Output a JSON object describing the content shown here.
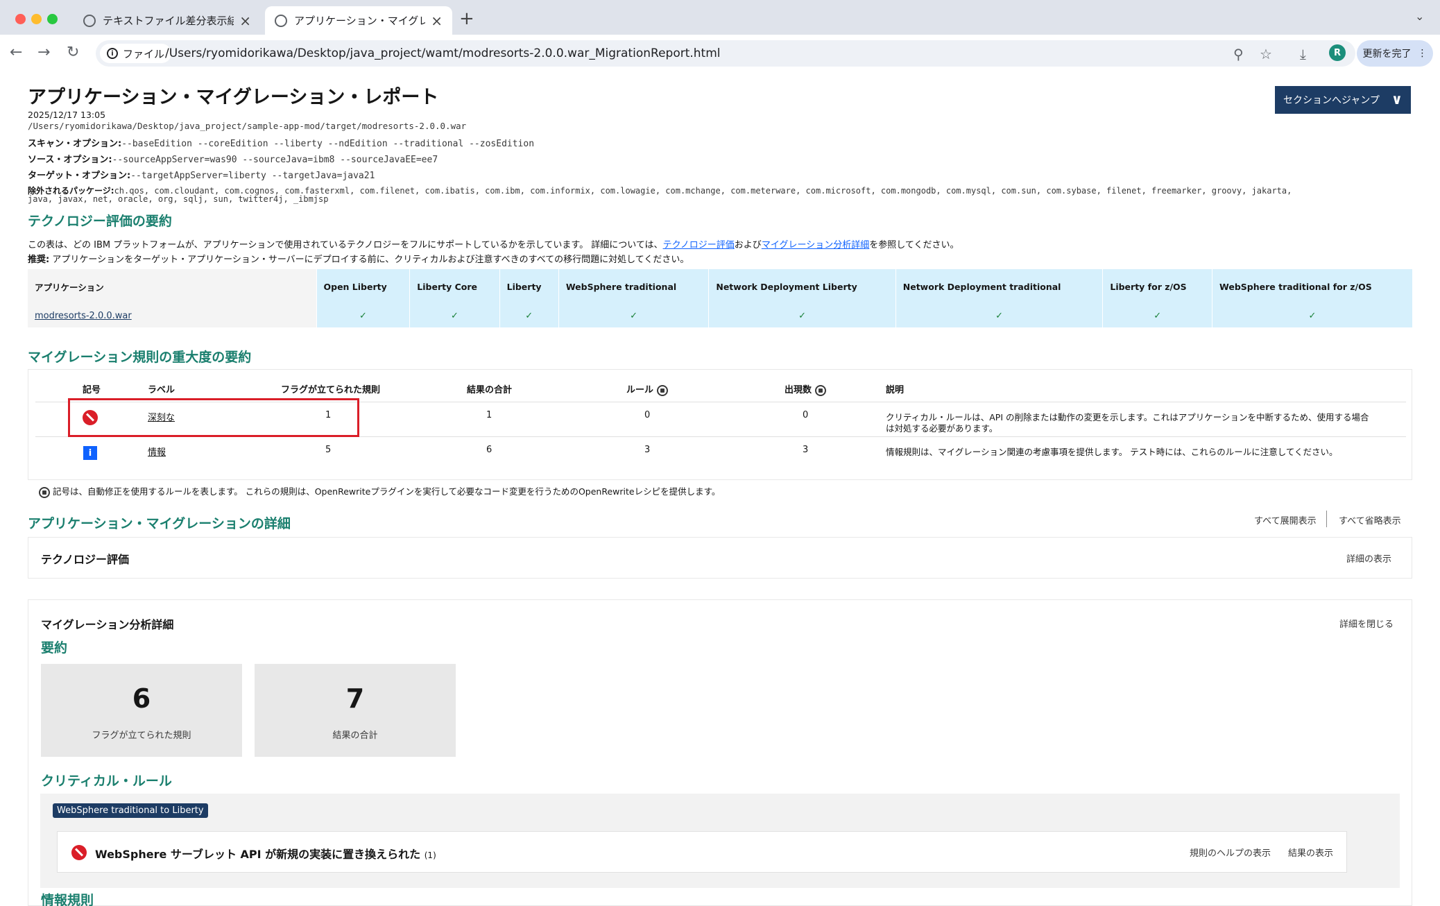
{
  "browser": {
    "tabs": [
      {
        "label": "テキストファイル差分表示結果",
        "active": false
      },
      {
        "label": "アプリケーション・マイグレーシ",
        "active": true
      }
    ],
    "address_chip": "ファイル",
    "url": "/Users/ryomidorikawa/Desktop/java_project/wamt/modresorts-2.0.0.war_MigrationReport.html",
    "avatar_letter": "R",
    "update_button": "更新を完了"
  },
  "report": {
    "title": "アプリケーション・マイグレーション・レポート",
    "jump_button": "セクションへジャンプ",
    "date": "2025/12/17 13:05",
    "path": "/Users/ryomidorikawa/Desktop/java_project/sample-app-mod/target/modresorts-2.0.0.war",
    "scan_label": "スキャン・オプション:",
    "scan_value": "--baseEdition --coreEdition --liberty --ndEdition --traditional --zosEdition",
    "source_label": "ソース・オプション:",
    "source_value": "--sourceAppServer=was90 --sourceJava=ibm8 --sourceJavaEE=ee7",
    "target_label": "ターゲット・オプション:",
    "target_value": "--targetAppServer=liberty --targetJava=java21",
    "excluded_label": "除外されるパッケージ:",
    "excluded_line1": "ch.qos, com.cloudant, com.cognos, com.fasterxml, com.filenet, com.ibatis, com.ibm, com.informix, com.lowagie, com.mchange, com.meterware, com.microsoft, com.mongodb, com.mysql, com.sun, com.sybase, filenet, freemarker, groovy, jakarta,",
    "excluded_line2": "java, javax, net, oracle, org, sqlj, sun, twitter4j, _ibmjsp"
  },
  "tech_summary": {
    "heading": "テクノロジー評価の要約",
    "desc_pre": "この表は、どの IBM プラットフォームが、アプリケーションで使用されているテクノロジーをフルにサポートしているかを示しています。 詳細については、",
    "desc_link1": "テクノロジー評価",
    "desc_mid": "および",
    "desc_link2": "マイグレーション分析詳細",
    "desc_post": "を参照してください。",
    "recommend_label": "推奨:",
    "recommend_text": " アプリケーションをターゲット・アプリケーション・サーバーにデプロイする前に、クリティカルおよび注意すべきのすべての移行問題に対処してください。",
    "app_header": "アプリケーション",
    "platforms": [
      "Open Liberty",
      "Liberty Core",
      "Liberty",
      "WebSphere traditional",
      "Network Deployment Liberty",
      "Network Deployment traditional",
      "Liberty for z/OS",
      "WebSphere traditional for z/OS"
    ],
    "app_name": "modresorts-2.0.0.war",
    "checks": [
      "✓",
      "✓",
      "✓",
      "✓",
      "✓",
      "✓",
      "✓",
      "✓"
    ]
  },
  "severity": {
    "heading": "マイグレーション規則の重大度の要約",
    "headers": {
      "symbol": "記号",
      "label": "ラベル",
      "flagged": "フラグが立てられた規則",
      "total": "結果の合計",
      "rules": "ルール",
      "occurrences": "出現数",
      "desc": "説明"
    },
    "rows": [
      {
        "label": "深刻な",
        "flagged": "1",
        "total": "1",
        "rules": "0",
        "occurrences": "0",
        "desc1": "クリティカル・ルールは、API の削除または動作の変更を示します。これはアプリケーションを中断するため、使用する場合",
        "desc2": "は対処する必要があります。"
      },
      {
        "label": "情報",
        "flagged": "5",
        "total": "6",
        "rules": "3",
        "occurrences": "3",
        "desc1": "情報規則は、マイグレーション関連の考慮事項を提供します。 テスト時には、これらのルールに注意してください。",
        "desc2": ""
      }
    ],
    "footnote": "記号は、自動修正を使用するルールを表します。 これらの規則は、OpenRewriteプラグインを実行して必要なコード変更を行うためのOpenRewriteレシピを提供します。",
    "info_symbol": "i"
  },
  "details": {
    "heading": "アプリケーション・マイグレーションの詳細",
    "expand_all": "すべて展開表示",
    "collapse_all": "すべて省略表示",
    "tech_eval_title": "テクノロジー評価",
    "tech_eval_link": "詳細の表示",
    "migration_title": "マイグレーション分析詳細",
    "migration_link": "詳細を閉じる",
    "summary_heading": "要約",
    "stats": [
      {
        "value": "6",
        "label": "フラグが立てられた規則"
      },
      {
        "value": "7",
        "label": "結果の合計"
      }
    ],
    "critical_heading": "クリティカル・ルール",
    "tag": "WebSphere traditional to Liberty",
    "rule_title": "WebSphere サーブレット API が新規の実装に置き換えられた",
    "rule_count": "(1)",
    "rule_help": "規則のヘルプの表示",
    "rule_results": "結果の表示",
    "info_heading": "情報規則"
  }
}
